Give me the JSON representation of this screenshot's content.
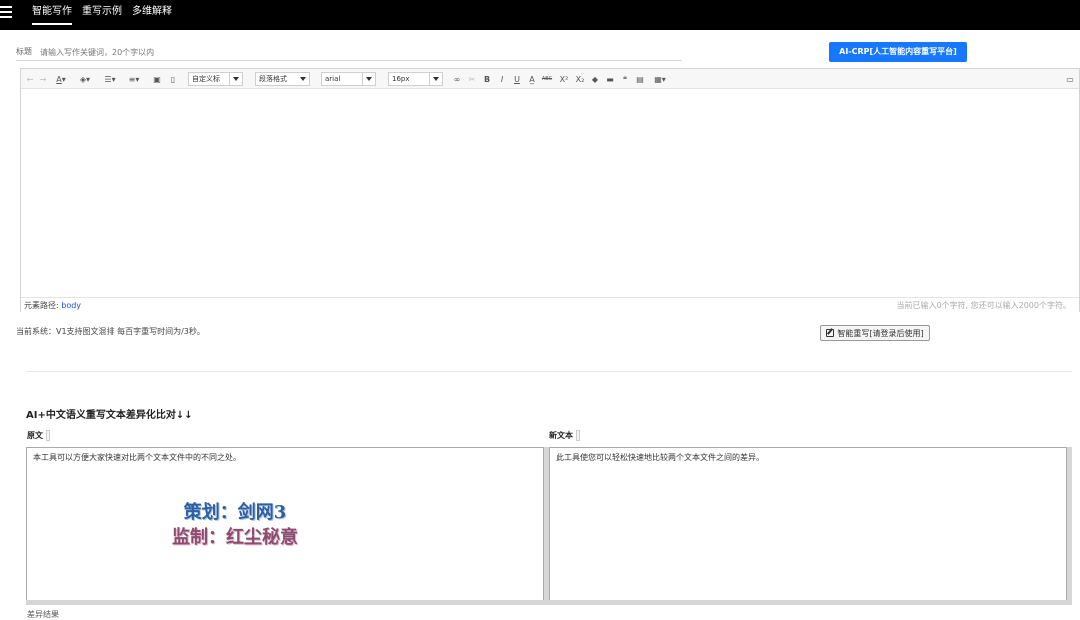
{
  "nav": {
    "items": [
      {
        "label": "智能写作",
        "active": true
      },
      {
        "label": "重写示例",
        "active": false
      },
      {
        "label": "多维解释",
        "active": false
      }
    ]
  },
  "title_field": {
    "label": "标题",
    "placeholder": "请输入写作关键词，20个字以内",
    "value": ""
  },
  "ai_button": {
    "label": "AI-CRP[人工智能内容重写平台]"
  },
  "toolbar": {
    "custom_title": "自定义标",
    "paragraph_format": "段落格式",
    "font_family": "arial",
    "font_size": "16px",
    "icons": [
      "undo-icon",
      "redo-icon",
      "font-color-icon",
      "highlight-icon",
      "ordered-list-icon",
      "unordered-list-icon",
      "select-all-icon",
      "clear-doc-icon",
      "link-icon",
      "unlink-icon",
      "bold-icon",
      "italic-icon",
      "underline-icon",
      "fontborder-icon",
      "strikethrough-icon",
      "superscript-icon",
      "subscript-icon",
      "removeformat-icon",
      "formatmatch-icon",
      "blockquote-icon",
      "paste-plain-icon",
      "insert-table-icon",
      "preview-icon"
    ]
  },
  "statusbar": {
    "path_label": "元素路径:",
    "path_value": "body",
    "counter": "当前已输入0个字符, 您还可以输入2000个字符。"
  },
  "system_line": "当前系统：V1支持图文混排 每百字重写时间为/3秒。",
  "rewrite_button": {
    "label": "智能重写[请登录后使用]"
  },
  "compare": {
    "title": "AI+中文语义重写文本差异化比对↓↓",
    "left_label": "原文",
    "right_label": "新文本",
    "left_text": "本工具可以方便大家快速对比两个文本文件中的不同之处。",
    "right_text": "此工具使您可以轻松快速地比较两个文本文件之间的差异。"
  },
  "watermark": {
    "line1": "策划：剑网3",
    "line2": "监制：红尘秘意"
  },
  "bottom_text": "差异结果"
}
